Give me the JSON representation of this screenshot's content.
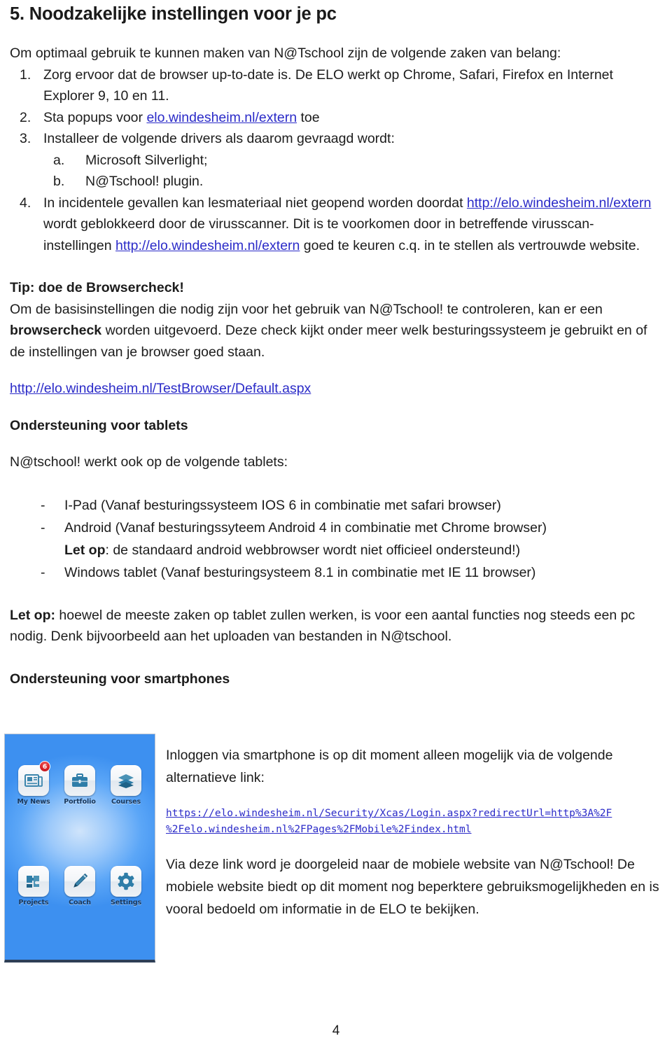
{
  "document": {
    "title": "5. Noodzakelijke instellingen voor je pc",
    "intro": "Om optimaal gebruik te kunnen maken van N@Tschool zijn de volgende zaken van belang:",
    "numbered_items": [
      {
        "marker": "1.",
        "text": "Zorg ervoor dat de browser up-to-date is. De ELO werkt op Chrome, Safari, Firefox en Internet Explorer 9, 10 en 11."
      },
      {
        "marker": "2.",
        "text_before": "Sta popups voor ",
        "link": "elo.windesheim.nl/extern",
        "text_after": " toe"
      },
      {
        "marker": "3.",
        "text": "Installeer de volgende drivers als daarom gevraagd wordt:",
        "sub_items": [
          {
            "marker": "a.",
            "text": "Microsoft Silverlight;"
          },
          {
            "marker": "b.",
            "text": "N@Tschool! plugin."
          }
        ]
      },
      {
        "marker": "4.",
        "part1": "In incidentele gevallen kan lesmateriaal niet geopend worden doordat ",
        "link1": "http://elo.windesheim.nl/extern",
        "part2": " wordt geblokkeerd door de virusscanner. Dit is te voorkomen door in betreffende virusscan-instellingen ",
        "link2": "http://elo.windesheim.nl/extern",
        "part3": " goed te keuren c.q. in te stellen als vertrouwde website."
      }
    ],
    "tip_heading": "Tip: doe de Browsercheck!",
    "tip_body_1": "Om de basisinstellingen die nodig zijn voor het gebruik van N@Tschool! te controleren, kan er een ",
    "tip_body_bold": "browsercheck",
    "tip_body_2": " worden uitgevoerd. Deze check kijkt onder meer welk besturingssysteem je gebruikt en of de instellingen van je browser goed staan.",
    "browsercheck_link": "http://elo.windesheim.nl/TestBrowser/Default.aspx",
    "tablets_heading": "Ondersteuning voor tablets",
    "tablets_intro": "N@tschool! werkt ook op de volgende tablets:",
    "tablet_bullets": [
      {
        "marker": "-",
        "text": "I-Pad (Vanaf besturingssysteem IOS 6 in combinatie met safari browser)"
      },
      {
        "marker": "-",
        "text": "Android (Vanaf besturingssyteem Android 4 in combinatie met Chrome browser)"
      },
      {
        "marker": "-",
        "text": "Windows tablet (Vanaf besturingsysteem 8.1 in combinatie met IE 11 browser)"
      }
    ],
    "android_note_bold": "Let op",
    "android_note_rest": ": de standaard android webbrowser wordt niet officieel ondersteund!)",
    "tablet_warning_bold": "Let op:",
    "tablet_warning_rest": " hoewel de meeste zaken op tablet zullen werken, is voor een aantal functies nog steeds een pc nodig. Denk bijvoorbeeld aan het uploaden van bestanden in N@tschool.",
    "smartphones_heading": "Ondersteuning voor smartphones",
    "page_number": "4"
  },
  "phone_screenshot": {
    "apps": [
      {
        "label": "My News",
        "icon": "news-icon",
        "badge": "6"
      },
      {
        "label": "Portfolio",
        "icon": "briefcase-icon",
        "badge": ""
      },
      {
        "label": "Courses",
        "icon": "layers-icon",
        "badge": ""
      },
      {
        "label": "Projects",
        "icon": "puzzle-icon",
        "badge": ""
      },
      {
        "label": "Coach",
        "icon": "pen-icon",
        "badge": ""
      },
      {
        "label": "Settings",
        "icon": "gear-icon",
        "badge": ""
      }
    ],
    "background_color": "#5ba6f7",
    "badge_color": "#d61f26",
    "icon_color": "#2e7da8"
  },
  "smartphone_section": {
    "intro": "Inloggen via smartphone is op dit moment alleen mogelijk via de volgende alternatieve link:",
    "link_line_1": "https://elo.windesheim.nl/Security/Xcas/Login.aspx?redirectUrl=http%3A%2F",
    "link_line_2": "%2Felo.windesheim.nl%2FPages%2FMobile%2Findex.html",
    "outro": "Via deze link word je doorgeleid naar de mobiele website van N@Tschool! De mobiele website biedt op dit moment nog beperktere gebruiksmogelijkheden en is vooral bedoeld om informatie in de ELO te bekijken."
  },
  "colors": {
    "link": "#2b2bc8",
    "text": "#1c1c1c"
  }
}
